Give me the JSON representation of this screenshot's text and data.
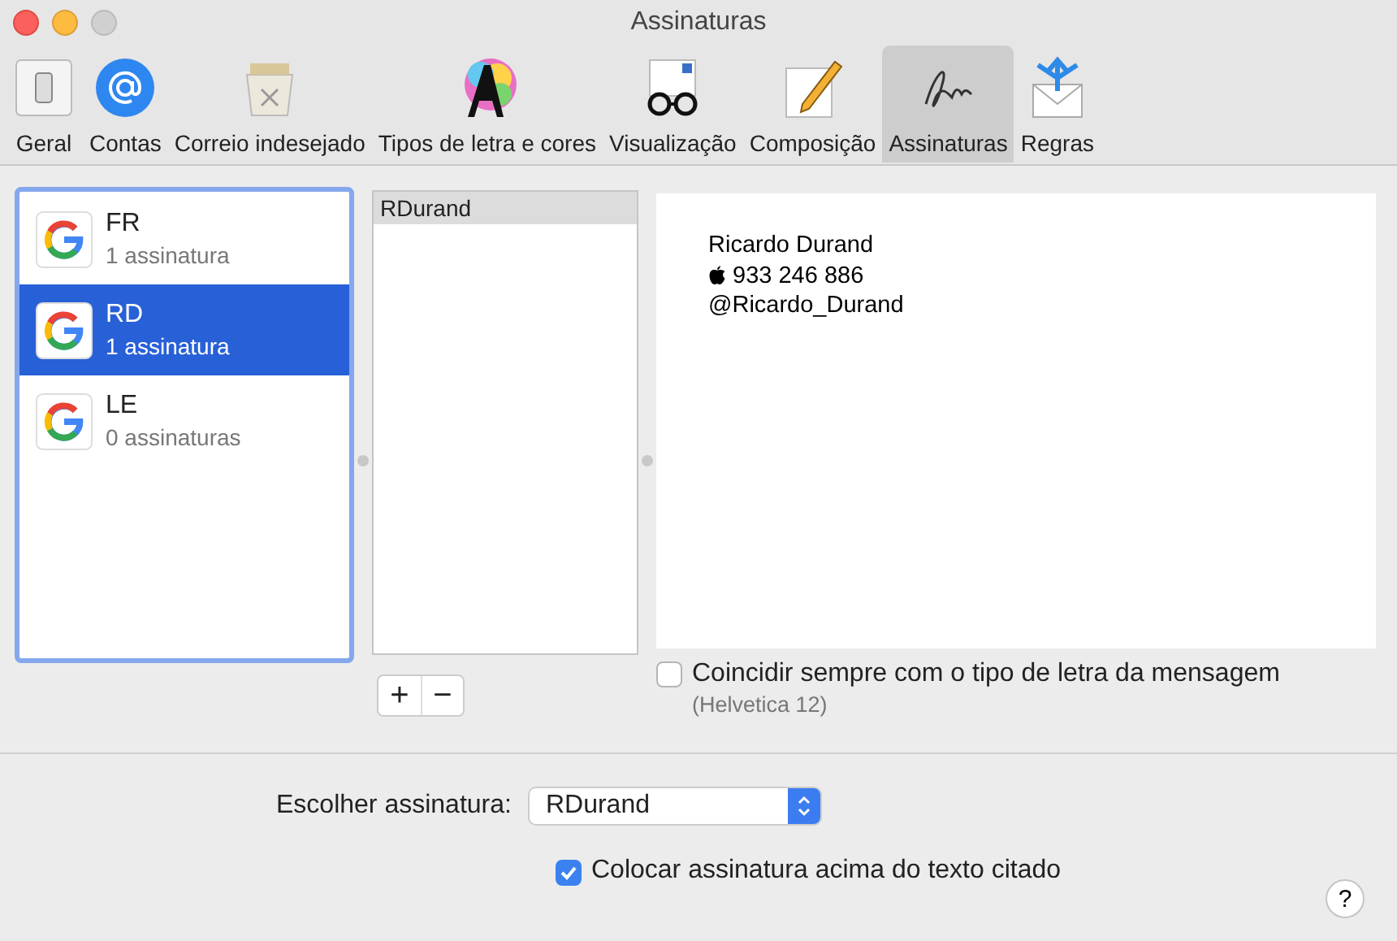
{
  "window": {
    "title": "Assinaturas"
  },
  "toolbar": [
    {
      "kind": "general",
      "label": "Geral",
      "selected": false
    },
    {
      "kind": "accounts",
      "label": "Contas",
      "selected": false
    },
    {
      "kind": "junk",
      "label": "Correio indesejado",
      "selected": false
    },
    {
      "kind": "fonts",
      "label": "Tipos de letra e cores",
      "selected": false
    },
    {
      "kind": "viewing",
      "label": "Visualização",
      "selected": false
    },
    {
      "kind": "composing",
      "label": "Composição",
      "selected": false
    },
    {
      "kind": "signatures",
      "label": "Assinaturas",
      "selected": true
    },
    {
      "kind": "rules",
      "label": "Regras",
      "selected": false
    }
  ],
  "accounts": [
    {
      "name": "FR",
      "count": "1 assinatura",
      "selected": false
    },
    {
      "name": "RD",
      "count": "1 assinatura",
      "selected": true
    },
    {
      "name": "LE",
      "count": "0 assinaturas",
      "selected": false
    }
  ],
  "signatures": [
    {
      "name": "RDurand",
      "selected": true
    }
  ],
  "preview": {
    "lines": [
      {
        "kind": "text",
        "text": "Ricardo Durand"
      },
      {
        "kind": "phone",
        "text": "933 246 886"
      },
      {
        "kind": "text",
        "text": "@Ricardo_Durand"
      }
    ]
  },
  "add_button": "+",
  "remove_button": "−",
  "match_font": {
    "label": "Coincidir sempre com o tipo de letra da mensagem",
    "note": "(Helvetica 12)",
    "checked": false
  },
  "choose": {
    "label": "Escolher assinatura:",
    "value": "RDurand"
  },
  "place_above": {
    "label": "Colocar assinatura acima do texto citado",
    "checked": true
  },
  "help_button": "?"
}
